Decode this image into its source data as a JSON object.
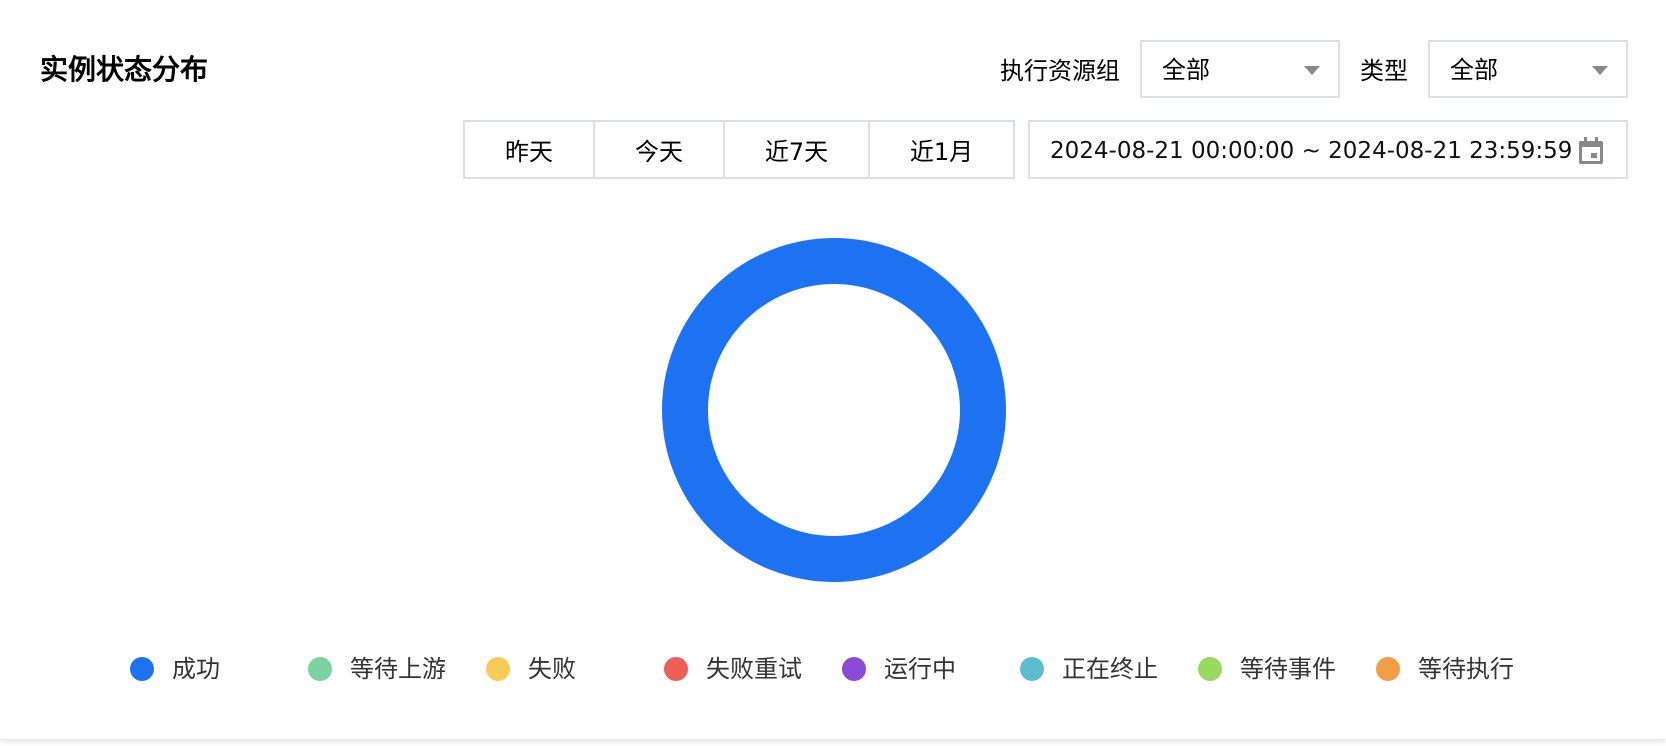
{
  "title": "实例状态分布",
  "filters": {
    "resource_group_label": "执行资源组",
    "resource_group_value": "全部",
    "type_label": "类型",
    "type_value": "全部"
  },
  "quick_ranges": [
    "昨天",
    "今天",
    "近7天",
    "近1月"
  ],
  "date_range": {
    "start": "2024-08-21 00:00:00",
    "end": "2024-08-21 23:59:59",
    "text": "2024-08-21 00:00:00   ~ 2024-08-21 23:59:59"
  },
  "chart_data": {
    "type": "pie",
    "title": "",
    "categories": [
      "成功",
      "等待上游",
      "失败",
      "失败重试",
      "运行中",
      "正在终止",
      "等待事件",
      "等待执行"
    ],
    "values": [
      1,
      0,
      0,
      0,
      0,
      0,
      0,
      0
    ],
    "colors": [
      "#1d72f2",
      "#7bd3a1",
      "#f8ca58",
      "#eb5f55",
      "#8b4bd6",
      "#5cbecd",
      "#98d95f",
      "#f49d47"
    ],
    "legend_position": "bottom",
    "donut": true
  },
  "icons": {
    "calendar": "calendar-icon",
    "caret": "chevron-down-icon"
  }
}
